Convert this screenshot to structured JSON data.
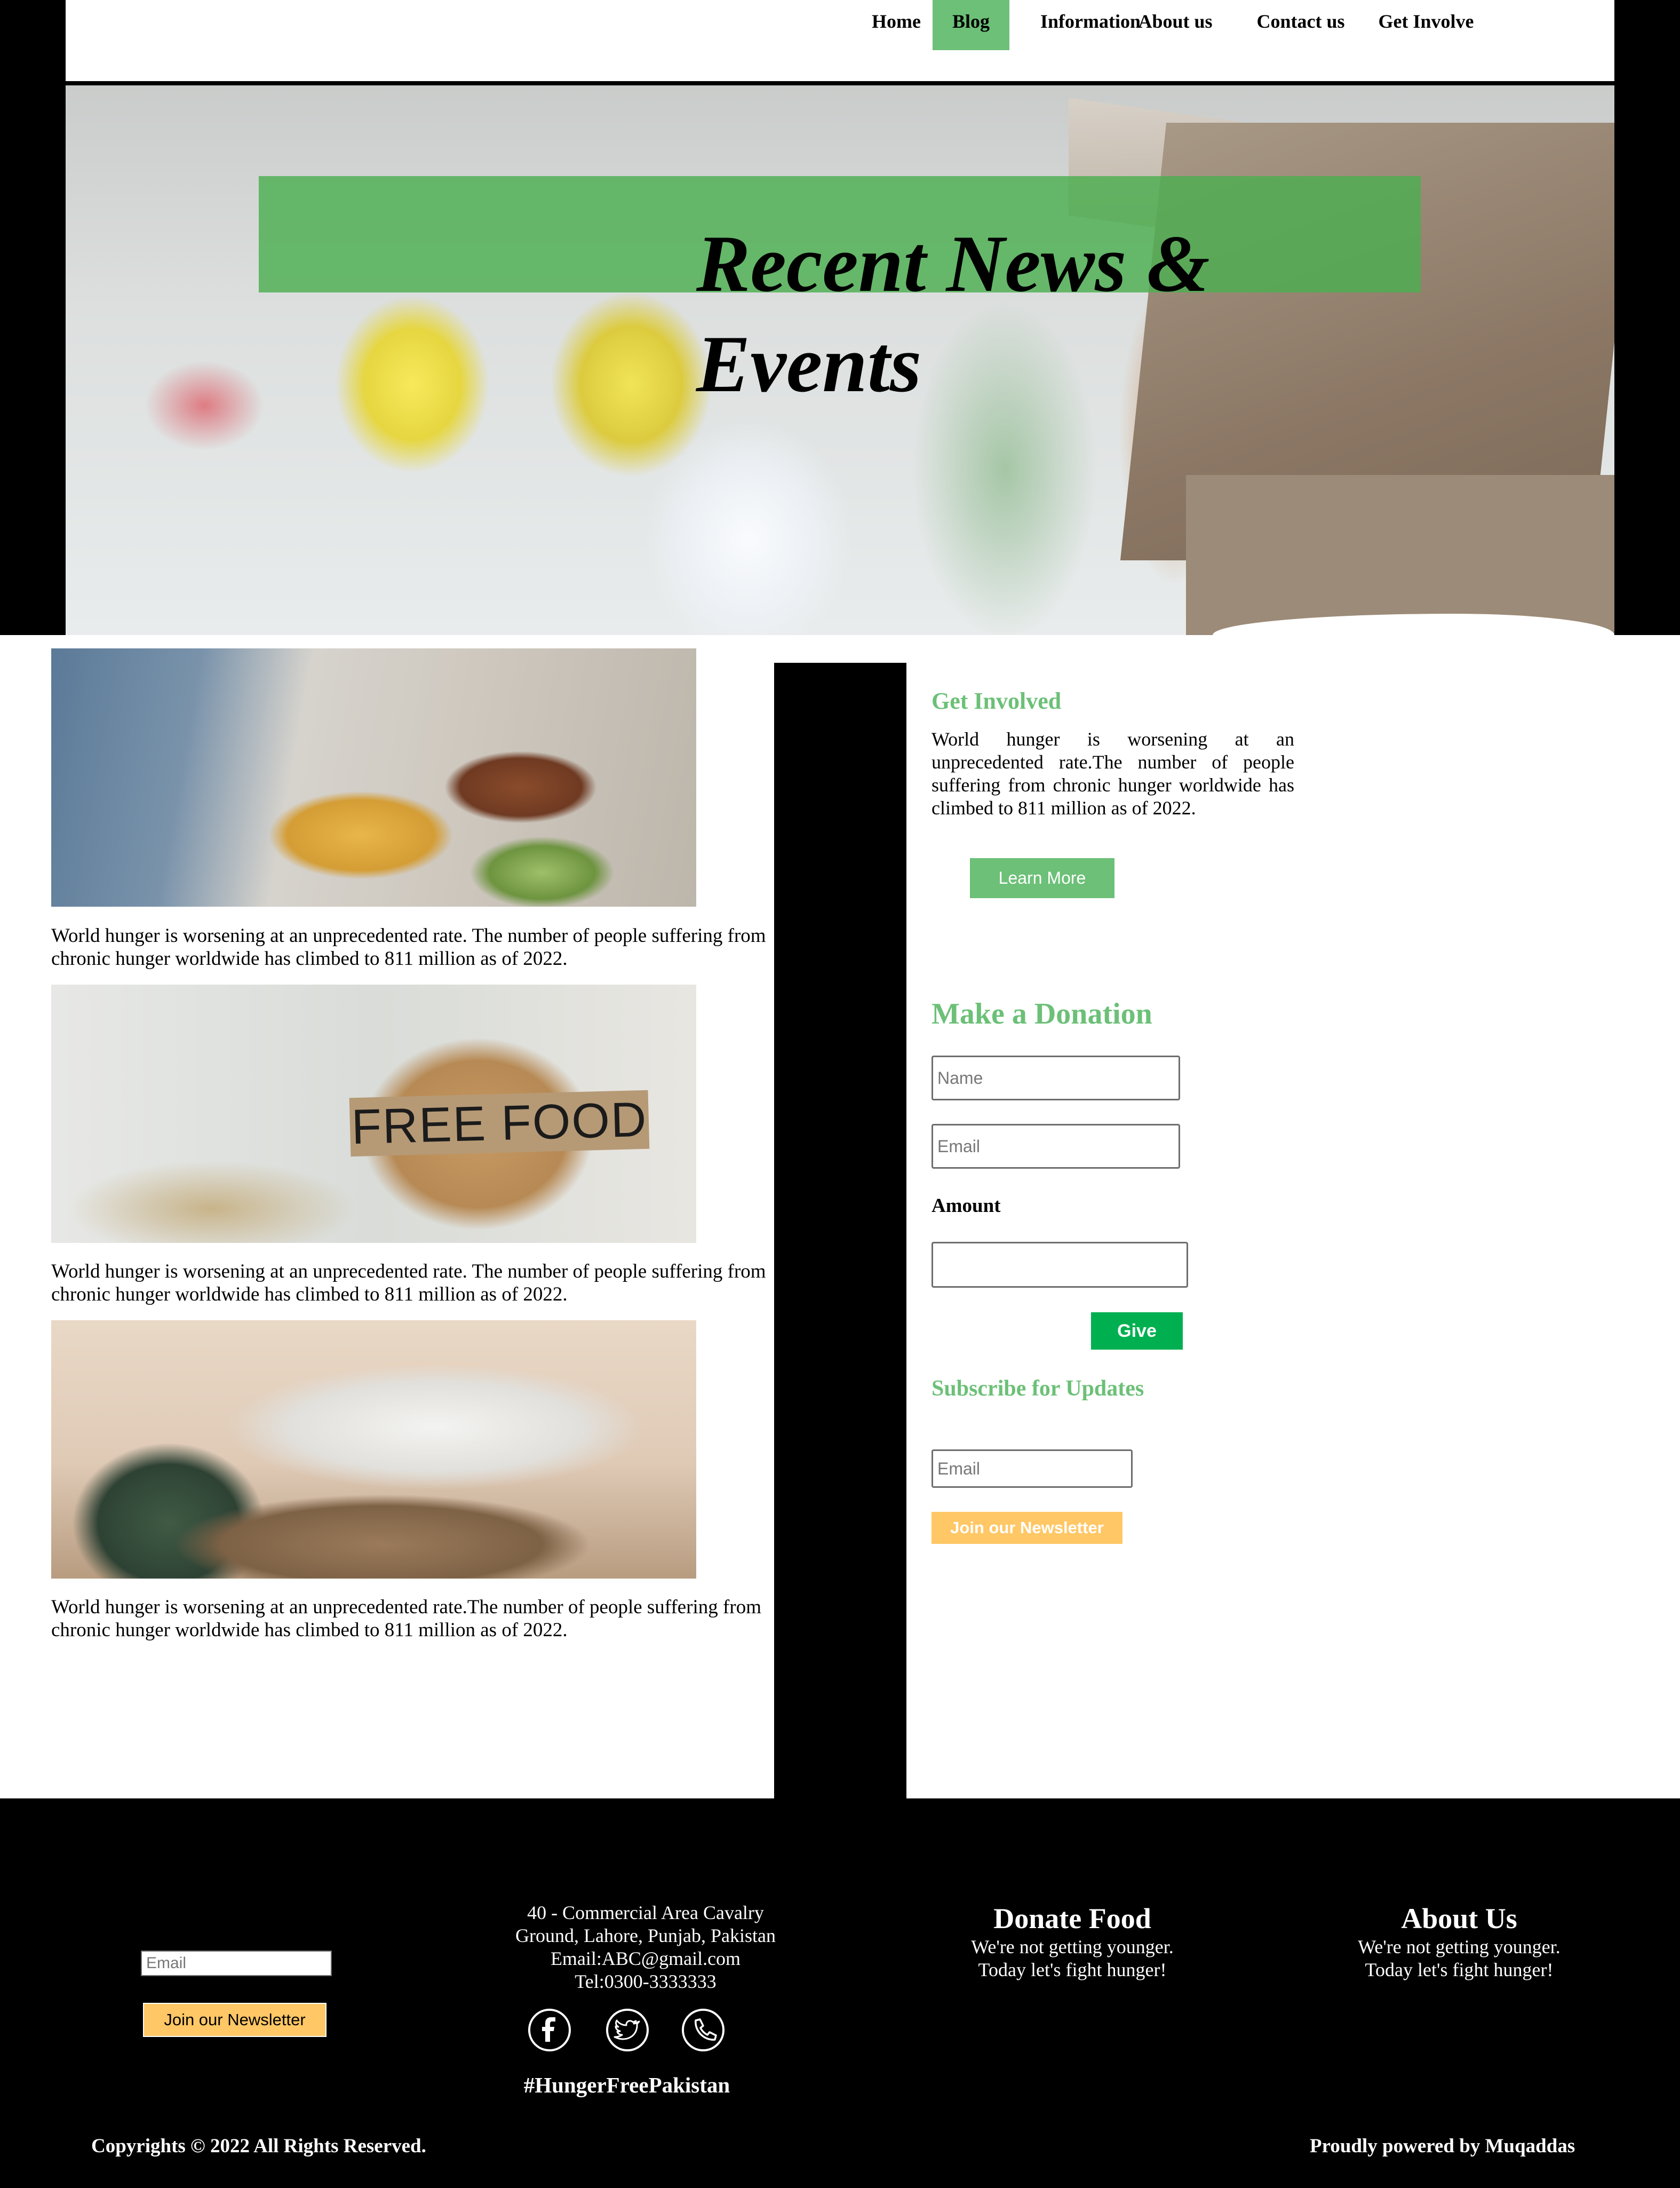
{
  "nav": {
    "items": [
      {
        "label": "Home"
      },
      {
        "label": "Blog"
      },
      {
        "label": "Information"
      },
      {
        "label": "About us"
      },
      {
        "label": "Contact us"
      },
      {
        "label": "Get Involve"
      }
    ],
    "active": "Blog",
    "active_color": "#6cc077"
  },
  "hero": {
    "title_line1": "Recent News &",
    "title_line2": "Events",
    "band_color": "#4caf50"
  },
  "posts": [
    {
      "image": "volunteers-packing-food-trays",
      "caption": "World hunger is worsening at an unprecedented rate. The number of people suffering from chronic hunger worldwide has climbed to 811 million as of 2022."
    },
    {
      "image": "person-holding-free-food-sign",
      "sign_text": "FREE FOOD",
      "caption": "World hunger is worsening at an unprecedented rate. The number of people suffering from chronic hunger worldwide has climbed to 811 million as of 2022."
    },
    {
      "image": "volunteers-serving-food",
      "caption": "World hunger is worsening at an unprecedented rate.The number of people suffering from chronic hunger worldwide has climbed to 811 million as of 2022."
    }
  ],
  "sidebar": {
    "get_involved": {
      "heading": "Get Involved",
      "text": "World hunger is worsening at an unprecedented rate.The number of people suffering from chronic hunger worldwide has climbed to 811 million as of 2022.",
      "button": "Learn More"
    },
    "donation": {
      "heading": "Make a Donation",
      "name_placeholder": "Name",
      "email_placeholder": "Email",
      "amount_label": "Amount",
      "amount_value": "",
      "button": "Give"
    },
    "subscribe": {
      "heading": "Subscribe for Updates",
      "email_placeholder": "Email",
      "button": "Join our Newsletter"
    }
  },
  "footer": {
    "newsletter": {
      "email_placeholder": "Email",
      "button": "Join our Newsletter"
    },
    "address": {
      "line1": "40 - Commercial Area Cavalry",
      "line2": "Ground, Lahore, Punjab, Pakistan",
      "email": "Email:ABC@gmail.com",
      "phone": "Tel:0300-3333333"
    },
    "social": [
      {
        "icon": "facebook-icon"
      },
      {
        "icon": "twitter-icon"
      },
      {
        "icon": "phone-icon"
      }
    ],
    "hashtag": "#HungerFreePakistan",
    "donate": {
      "title": "Donate Food",
      "line1": "We're not getting younger.",
      "line2": "Today let's fight hunger!"
    },
    "about": {
      "title": "About Us",
      "line1": "We're not getting younger.",
      "line2": "Today let's fight hunger!"
    },
    "copyright": "Copyrights © 2022 All Rights Reserved.",
    "powered": "Proudly powered by Muqaddas"
  },
  "colors": {
    "accent_green": "#6cc077",
    "give_green": "#00b050",
    "newsletter_yellow": "#ffc765",
    "footer_bg": "#000000"
  }
}
